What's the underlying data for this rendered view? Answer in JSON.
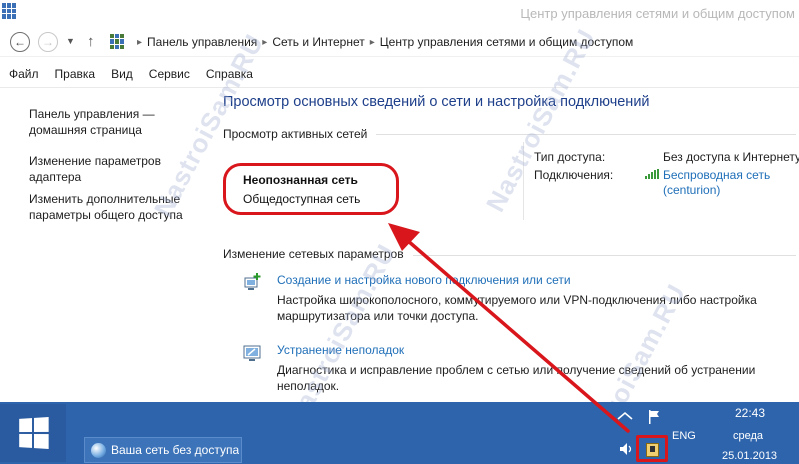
{
  "window": {
    "title": "Центр управления сетями и общим доступом"
  },
  "address_bar": {
    "breadcrumbs": [
      "Панель управления",
      "Сеть и Интернет",
      "Центр управления сетями и общим доступом"
    ]
  },
  "menu": [
    "Файл",
    "Правка",
    "Вид",
    "Сервис",
    "Справка"
  ],
  "left_nav": {
    "home": "Панель управления — домашняя страница",
    "links": [
      "Изменение параметров адаптера",
      "Изменить дополнительные параметры общего доступа"
    ]
  },
  "main": {
    "title": "Просмотр основных сведений о сети и настройка подключений",
    "active_networks_header": "Просмотр активных сетей",
    "network": {
      "name": "Неопознанная сеть",
      "type": "Общедоступная сеть",
      "access_label": "Тип доступа:",
      "access_value": "Без доступа к Интернету",
      "connections_label": "Подключения:",
      "connection_name": "Беспроводная сеть",
      "connection_ssid": "(centurion)"
    },
    "change_settings_header": "Изменение сетевых параметров",
    "tasks": [
      {
        "link": "Создание и настройка нового подключения или сети",
        "description": "Настройка широкополосного, коммутируемого или VPN-подключения либо настройка маршрутизатора или точки доступа."
      },
      {
        "link": "Устранение неполадок",
        "description": "Диагностика и исправление проблем с сетью или получение сведений об устранении неполадок."
      }
    ]
  },
  "watermark": "NastroiSam.RU",
  "taskbar": {
    "notification": "Ваша сеть без доступа",
    "language": "ENG",
    "time": "22:43",
    "day": "среда",
    "date": "25.01.2013"
  },
  "colors": {
    "title_blue": "#1e3f8a",
    "link_blue": "#1f6fb8",
    "highlight_red": "#d8161b",
    "taskbar_blue": "#2e64ac"
  }
}
